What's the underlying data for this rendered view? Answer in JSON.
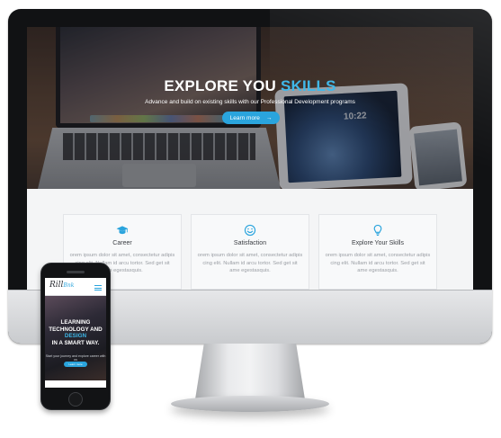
{
  "desktop_site": {
    "hero": {
      "title_main": "EXPLORE YOU",
      "title_accent": "SKILLS",
      "subtitle": "Advance and build on existing skills with our Professional Development programs",
      "button_label": "Learn more",
      "button_arrow": "→",
      "tablet_clock": "10:22"
    },
    "features": [
      {
        "icon": "graduation-cap-icon",
        "title": "Career",
        "text": "orem ipsum dolor sit amet, consectetur adipis cing elit. Nullam id arcu tortor. Sed get sit ame egestasquis."
      },
      {
        "icon": "smiley-icon",
        "title": "Satisfaction",
        "text": "orem ipsum dolor sit amet, consectetur adipis cing elit. Nullam id arcu tortor. Sed get sit ame egestasquis."
      },
      {
        "icon": "lightbulb-icon",
        "title": "Explore Your Skills",
        "text": "orem ipsum dolor sit amet, consectetur adipis cing elit. Nullam id arcu tortor. Sed get sit ame egestasquis."
      }
    ]
  },
  "mobile_site": {
    "logo": "Rill",
    "logo_mark": "Bnk",
    "title_line1": "LEARNING",
    "title_line2": "TECHNOLOGY AND",
    "title_accent": "DESIGN",
    "title_line4": "IN A SMART WAY.",
    "subtitle": "Start your journey and explore career with us",
    "button_label": "Learn more"
  },
  "colors": {
    "accent": "#2aa4dd",
    "hero_accent_text": "#3eb7e8"
  }
}
